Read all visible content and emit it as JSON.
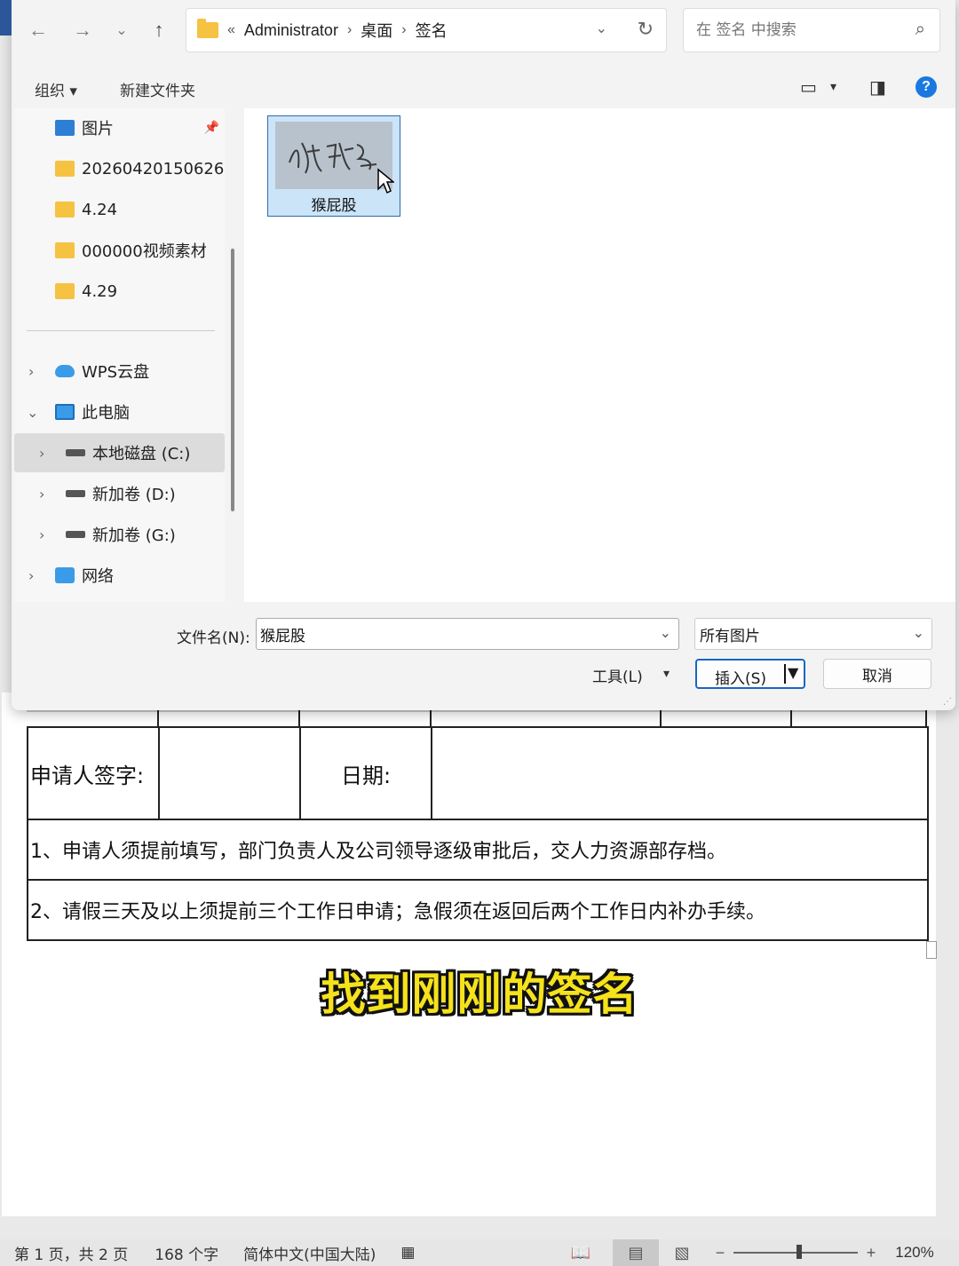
{
  "dialog": {
    "breadcrumb": {
      "overflow": "«",
      "items": [
        "Administrator",
        "桌面",
        "签名"
      ]
    },
    "search_placeholder": "在 签名 中搜索",
    "toolbar": {
      "organize": "组织 ▾",
      "new_folder": "新建文件夹"
    },
    "sidebar": {
      "quick_access": [
        {
          "label": "图片",
          "icon": "picture-icon",
          "pinned": true
        },
        {
          "label": "20260420150626",
          "icon": "folder-icon"
        },
        {
          "label": "4.24",
          "icon": "folder-icon"
        },
        {
          "label": "000000视频素材",
          "icon": "folder-icon"
        },
        {
          "label": "4.29",
          "icon": "folder-icon"
        }
      ],
      "tree": [
        {
          "label": "WPS云盘",
          "icon": "cloud-icon"
        },
        {
          "label": "此电脑",
          "icon": "computer-icon",
          "expanded": true
        },
        {
          "label": "本地磁盘 (C:)",
          "icon": "drive-icon",
          "selected": true
        },
        {
          "label": "新加卷 (D:)",
          "icon": "drive-icon"
        },
        {
          "label": "新加卷 (G:)",
          "icon": "drive-icon"
        },
        {
          "label": "网络",
          "icon": "network-icon"
        }
      ]
    },
    "files": [
      {
        "name": "猴屁股",
        "selected": true
      }
    ],
    "bottom": {
      "filename_label": "文件名(N):",
      "filename_value": "猴屁股",
      "filter": "所有图片",
      "tools": "工具(L)",
      "insert": "插入(S)",
      "cancel": "取消"
    },
    "colors": {
      "accent": "#1a66c2",
      "selection": "#cce4f7"
    }
  },
  "document": {
    "sign_label": "申请人签字:",
    "date_label": "日期:",
    "note1": "1、申请人须提前填写，部门负责人及公司领导逐级审批后，交人力资源部存档。",
    "note2": "2、请假三天及以上须提前三个工作日申请；急假须在返回后两个工作日内补办手续。"
  },
  "subtitle": "找到刚刚的签名",
  "statusbar": {
    "page": "第 1 页，共 2 页",
    "words": "168 个字",
    "language": "简体中文(中国大陆)",
    "zoom_minus": "−",
    "zoom_plus": "+",
    "zoom": "120%",
    "zoom_percent": 120
  }
}
